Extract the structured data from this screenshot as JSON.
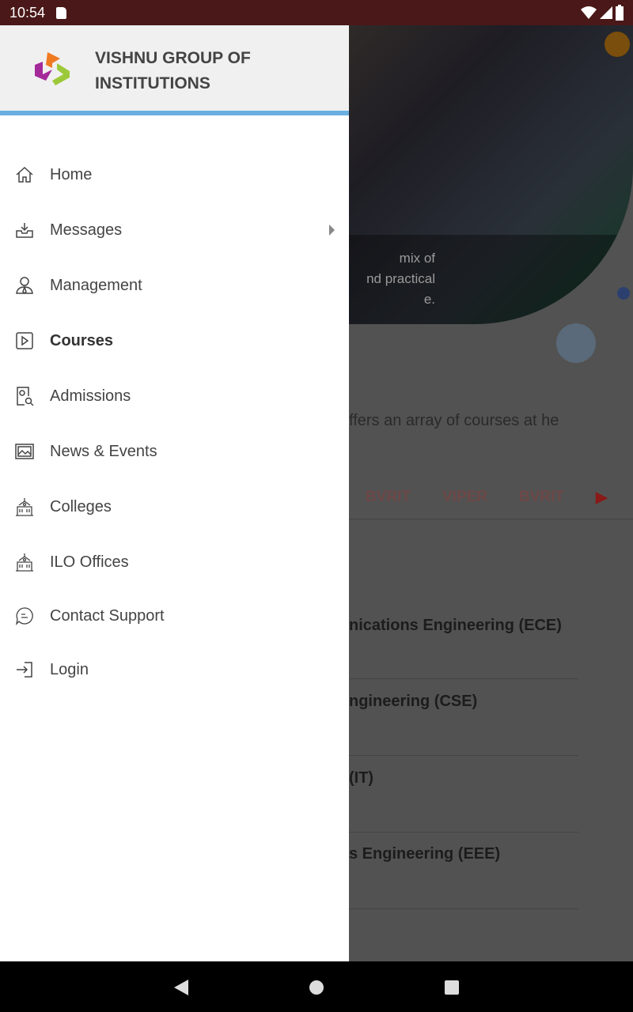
{
  "status_bar": {
    "time": "10:54"
  },
  "drawer": {
    "title": "VISHNU GROUP OF INSTITUTIONS",
    "items": [
      {
        "label": "Home",
        "icon": "home-icon"
      },
      {
        "label": "Messages",
        "icon": "inbox-icon",
        "has_submenu": true
      },
      {
        "label": "Management",
        "icon": "person-icon"
      },
      {
        "label": "Courses",
        "icon": "play-box-icon",
        "active": true
      },
      {
        "label": "Admissions",
        "icon": "document-search-icon"
      },
      {
        "label": "News & Events",
        "icon": "image-icon"
      },
      {
        "label": "Colleges",
        "icon": "building-icon"
      },
      {
        "label": "ILO Offices",
        "icon": "building-icon"
      },
      {
        "label": "Contact Support",
        "icon": "chat-icon"
      },
      {
        "label": "Login",
        "icon": "login-icon"
      }
    ]
  },
  "background": {
    "hero_caption": [
      "mix of",
      "nd practical",
      "e."
    ],
    "intro": "ffers an array of courses at he",
    "tabs": [
      "BVRIT",
      "VIPER",
      "BVRIT"
    ],
    "courses": [
      "nications Engineering (ECE)",
      "ngineering (CSE)",
      "(IT)",
      "s Engineering (EEE)"
    ]
  },
  "colors": {
    "status_bar": "#4a1818",
    "accent_line": "#6aafe0"
  }
}
